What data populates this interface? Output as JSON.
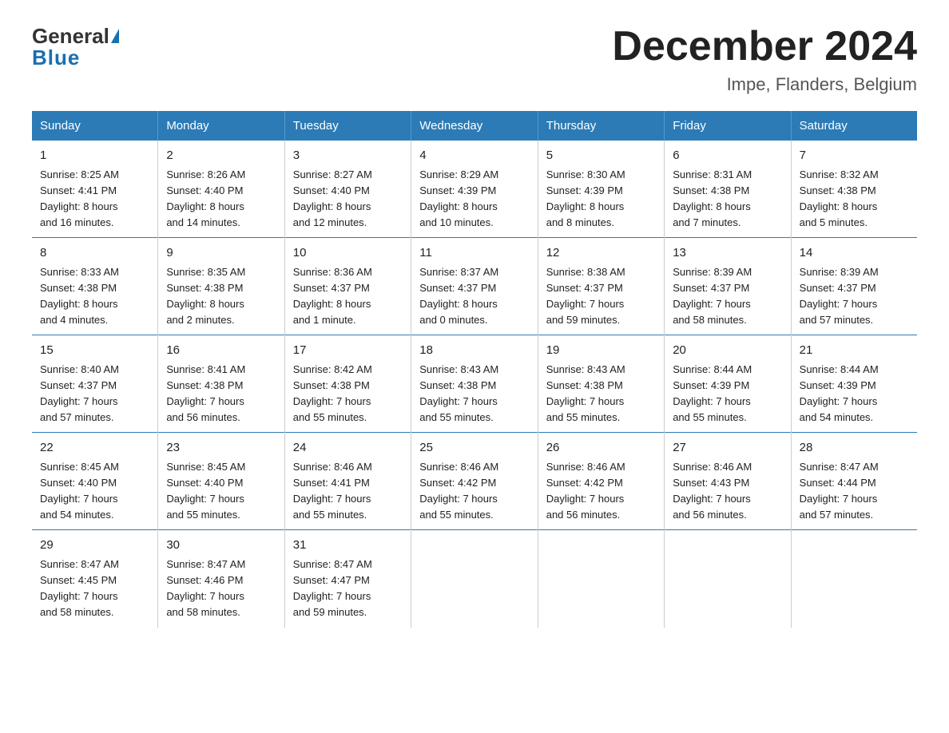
{
  "logo": {
    "general": "General",
    "blue": "Blue"
  },
  "title": "December 2024",
  "subtitle": "Impe, Flanders, Belgium",
  "days_header": [
    "Sunday",
    "Monday",
    "Tuesday",
    "Wednesday",
    "Thursday",
    "Friday",
    "Saturday"
  ],
  "weeks": [
    [
      {
        "day": "1",
        "info": "Sunrise: 8:25 AM\nSunset: 4:41 PM\nDaylight: 8 hours\nand 16 minutes."
      },
      {
        "day": "2",
        "info": "Sunrise: 8:26 AM\nSunset: 4:40 PM\nDaylight: 8 hours\nand 14 minutes."
      },
      {
        "day": "3",
        "info": "Sunrise: 8:27 AM\nSunset: 4:40 PM\nDaylight: 8 hours\nand 12 minutes."
      },
      {
        "day": "4",
        "info": "Sunrise: 8:29 AM\nSunset: 4:39 PM\nDaylight: 8 hours\nand 10 minutes."
      },
      {
        "day": "5",
        "info": "Sunrise: 8:30 AM\nSunset: 4:39 PM\nDaylight: 8 hours\nand 8 minutes."
      },
      {
        "day": "6",
        "info": "Sunrise: 8:31 AM\nSunset: 4:38 PM\nDaylight: 8 hours\nand 7 minutes."
      },
      {
        "day": "7",
        "info": "Sunrise: 8:32 AM\nSunset: 4:38 PM\nDaylight: 8 hours\nand 5 minutes."
      }
    ],
    [
      {
        "day": "8",
        "info": "Sunrise: 8:33 AM\nSunset: 4:38 PM\nDaylight: 8 hours\nand 4 minutes."
      },
      {
        "day": "9",
        "info": "Sunrise: 8:35 AM\nSunset: 4:38 PM\nDaylight: 8 hours\nand 2 minutes."
      },
      {
        "day": "10",
        "info": "Sunrise: 8:36 AM\nSunset: 4:37 PM\nDaylight: 8 hours\nand 1 minute."
      },
      {
        "day": "11",
        "info": "Sunrise: 8:37 AM\nSunset: 4:37 PM\nDaylight: 8 hours\nand 0 minutes."
      },
      {
        "day": "12",
        "info": "Sunrise: 8:38 AM\nSunset: 4:37 PM\nDaylight: 7 hours\nand 59 minutes."
      },
      {
        "day": "13",
        "info": "Sunrise: 8:39 AM\nSunset: 4:37 PM\nDaylight: 7 hours\nand 58 minutes."
      },
      {
        "day": "14",
        "info": "Sunrise: 8:39 AM\nSunset: 4:37 PM\nDaylight: 7 hours\nand 57 minutes."
      }
    ],
    [
      {
        "day": "15",
        "info": "Sunrise: 8:40 AM\nSunset: 4:37 PM\nDaylight: 7 hours\nand 57 minutes."
      },
      {
        "day": "16",
        "info": "Sunrise: 8:41 AM\nSunset: 4:38 PM\nDaylight: 7 hours\nand 56 minutes."
      },
      {
        "day": "17",
        "info": "Sunrise: 8:42 AM\nSunset: 4:38 PM\nDaylight: 7 hours\nand 55 minutes."
      },
      {
        "day": "18",
        "info": "Sunrise: 8:43 AM\nSunset: 4:38 PM\nDaylight: 7 hours\nand 55 minutes."
      },
      {
        "day": "19",
        "info": "Sunrise: 8:43 AM\nSunset: 4:38 PM\nDaylight: 7 hours\nand 55 minutes."
      },
      {
        "day": "20",
        "info": "Sunrise: 8:44 AM\nSunset: 4:39 PM\nDaylight: 7 hours\nand 55 minutes."
      },
      {
        "day": "21",
        "info": "Sunrise: 8:44 AM\nSunset: 4:39 PM\nDaylight: 7 hours\nand 54 minutes."
      }
    ],
    [
      {
        "day": "22",
        "info": "Sunrise: 8:45 AM\nSunset: 4:40 PM\nDaylight: 7 hours\nand 54 minutes."
      },
      {
        "day": "23",
        "info": "Sunrise: 8:45 AM\nSunset: 4:40 PM\nDaylight: 7 hours\nand 55 minutes."
      },
      {
        "day": "24",
        "info": "Sunrise: 8:46 AM\nSunset: 4:41 PM\nDaylight: 7 hours\nand 55 minutes."
      },
      {
        "day": "25",
        "info": "Sunrise: 8:46 AM\nSunset: 4:42 PM\nDaylight: 7 hours\nand 55 minutes."
      },
      {
        "day": "26",
        "info": "Sunrise: 8:46 AM\nSunset: 4:42 PM\nDaylight: 7 hours\nand 56 minutes."
      },
      {
        "day": "27",
        "info": "Sunrise: 8:46 AM\nSunset: 4:43 PM\nDaylight: 7 hours\nand 56 minutes."
      },
      {
        "day": "28",
        "info": "Sunrise: 8:47 AM\nSunset: 4:44 PM\nDaylight: 7 hours\nand 57 minutes."
      }
    ],
    [
      {
        "day": "29",
        "info": "Sunrise: 8:47 AM\nSunset: 4:45 PM\nDaylight: 7 hours\nand 58 minutes."
      },
      {
        "day": "30",
        "info": "Sunrise: 8:47 AM\nSunset: 4:46 PM\nDaylight: 7 hours\nand 58 minutes."
      },
      {
        "day": "31",
        "info": "Sunrise: 8:47 AM\nSunset: 4:47 PM\nDaylight: 7 hours\nand 59 minutes."
      },
      {
        "day": "",
        "info": ""
      },
      {
        "day": "",
        "info": ""
      },
      {
        "day": "",
        "info": ""
      },
      {
        "day": "",
        "info": ""
      }
    ]
  ]
}
